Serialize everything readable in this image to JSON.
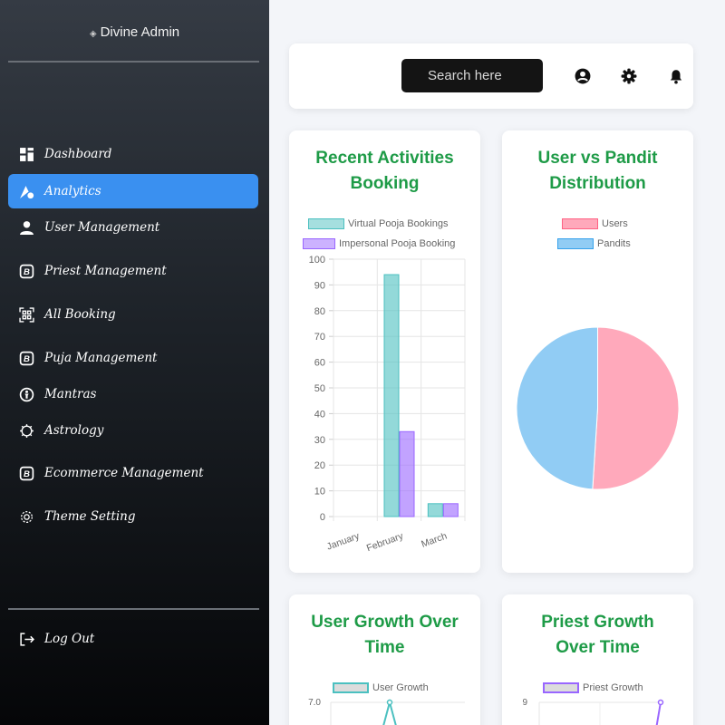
{
  "sidebar": {
    "brand": "Divine Admin",
    "items": [
      {
        "label": "Dashboard",
        "icon": "dashboard-icon"
      },
      {
        "label": "Analytics",
        "icon": "analytics-icon",
        "active": true
      },
      {
        "label": "User Management",
        "icon": "user-icon"
      },
      {
        "label": "Priest Management",
        "icon": "priest-icon"
      },
      {
        "label": "All Booking",
        "icon": "booking-icon"
      },
      {
        "label": "Puja Management",
        "icon": "puja-icon"
      },
      {
        "label": "Mantras",
        "icon": "mantras-icon"
      },
      {
        "label": "Astrology",
        "icon": "astrology-icon"
      },
      {
        "label": "Ecommerce Management",
        "icon": "ecommerce-icon"
      },
      {
        "label": "Theme Setting",
        "icon": "theme-icon"
      }
    ],
    "logout": "Log Out"
  },
  "header": {
    "search_placeholder": "Search here",
    "icons": [
      "user-circle-icon",
      "gear-icon",
      "bell-icon"
    ]
  },
  "colors": {
    "accent": "#3a90f0",
    "title_green": "#1e9b47",
    "virtual": "#4bc0c0",
    "impersonal": "#9966ff",
    "users": "#ff6384",
    "pandits": "#36a2eb"
  },
  "cards": {
    "activities": {
      "title_line1": "Recent Activities",
      "title_line2": "Booking"
    },
    "distribution": {
      "title_line1": "User vs Pandit",
      "title_line2": "Distribution"
    },
    "user_growth": {
      "title_line1": "User Growth Over",
      "title_line2": "Time"
    },
    "priest_growth": {
      "title_line1": "Priest Growth",
      "title_line2": "Over Time"
    }
  },
  "chart_data": [
    {
      "type": "bar",
      "categories": [
        "January",
        "February",
        "March"
      ],
      "series": [
        {
          "name": "Virtual Pooja Bookings",
          "values": [
            0,
            94,
            5
          ]
        },
        {
          "name": "Impersonal Pooja Booking",
          "values": [
            0,
            33,
            5
          ]
        }
      ],
      "ylim": [
        0,
        100
      ],
      "yticks": [
        0,
        10,
        20,
        30,
        40,
        50,
        60,
        70,
        80,
        90,
        100
      ]
    },
    {
      "type": "pie",
      "labels": [
        "Users",
        "Pandits"
      ],
      "values": [
        51,
        49
      ]
    },
    {
      "type": "line",
      "series": [
        {
          "name": "User Growth"
        }
      ],
      "yticks_visible": [
        "7.0"
      ]
    },
    {
      "type": "line",
      "series": [
        {
          "name": "Priest Growth"
        }
      ],
      "yticks_visible": [
        "9"
      ]
    }
  ]
}
